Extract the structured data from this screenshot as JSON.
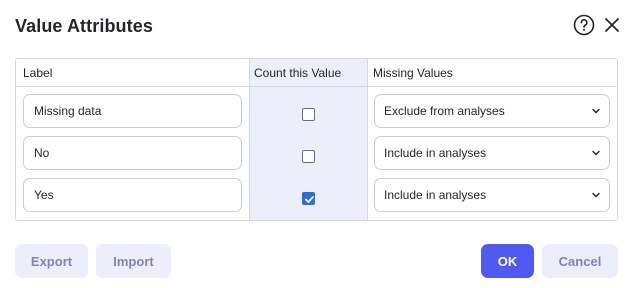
{
  "dialog": {
    "title": "Value Attributes"
  },
  "table": {
    "columns": [
      "Label",
      "Count this Value",
      "Missing Values"
    ],
    "rows": [
      {
        "label": "Missing data",
        "count": false,
        "missing": "Exclude from analyses"
      },
      {
        "label": "No",
        "count": false,
        "missing": "Include in analyses"
      },
      {
        "label": "Yes",
        "count": true,
        "missing": "Include in analyses"
      }
    ]
  },
  "footer": {
    "export_label": "Export",
    "import_label": "Import",
    "ok_label": "OK",
    "cancel_label": "Cancel"
  },
  "icons": {
    "help": "help-circle-icon",
    "close": "close-icon",
    "dropdown": "chevron-down-icon",
    "check": "checkmark-icon"
  },
  "colors": {
    "primary": "#4f5bf0",
    "secondary_bg": "#eceef9",
    "checkbox_checked": "#2c6fd8"
  }
}
